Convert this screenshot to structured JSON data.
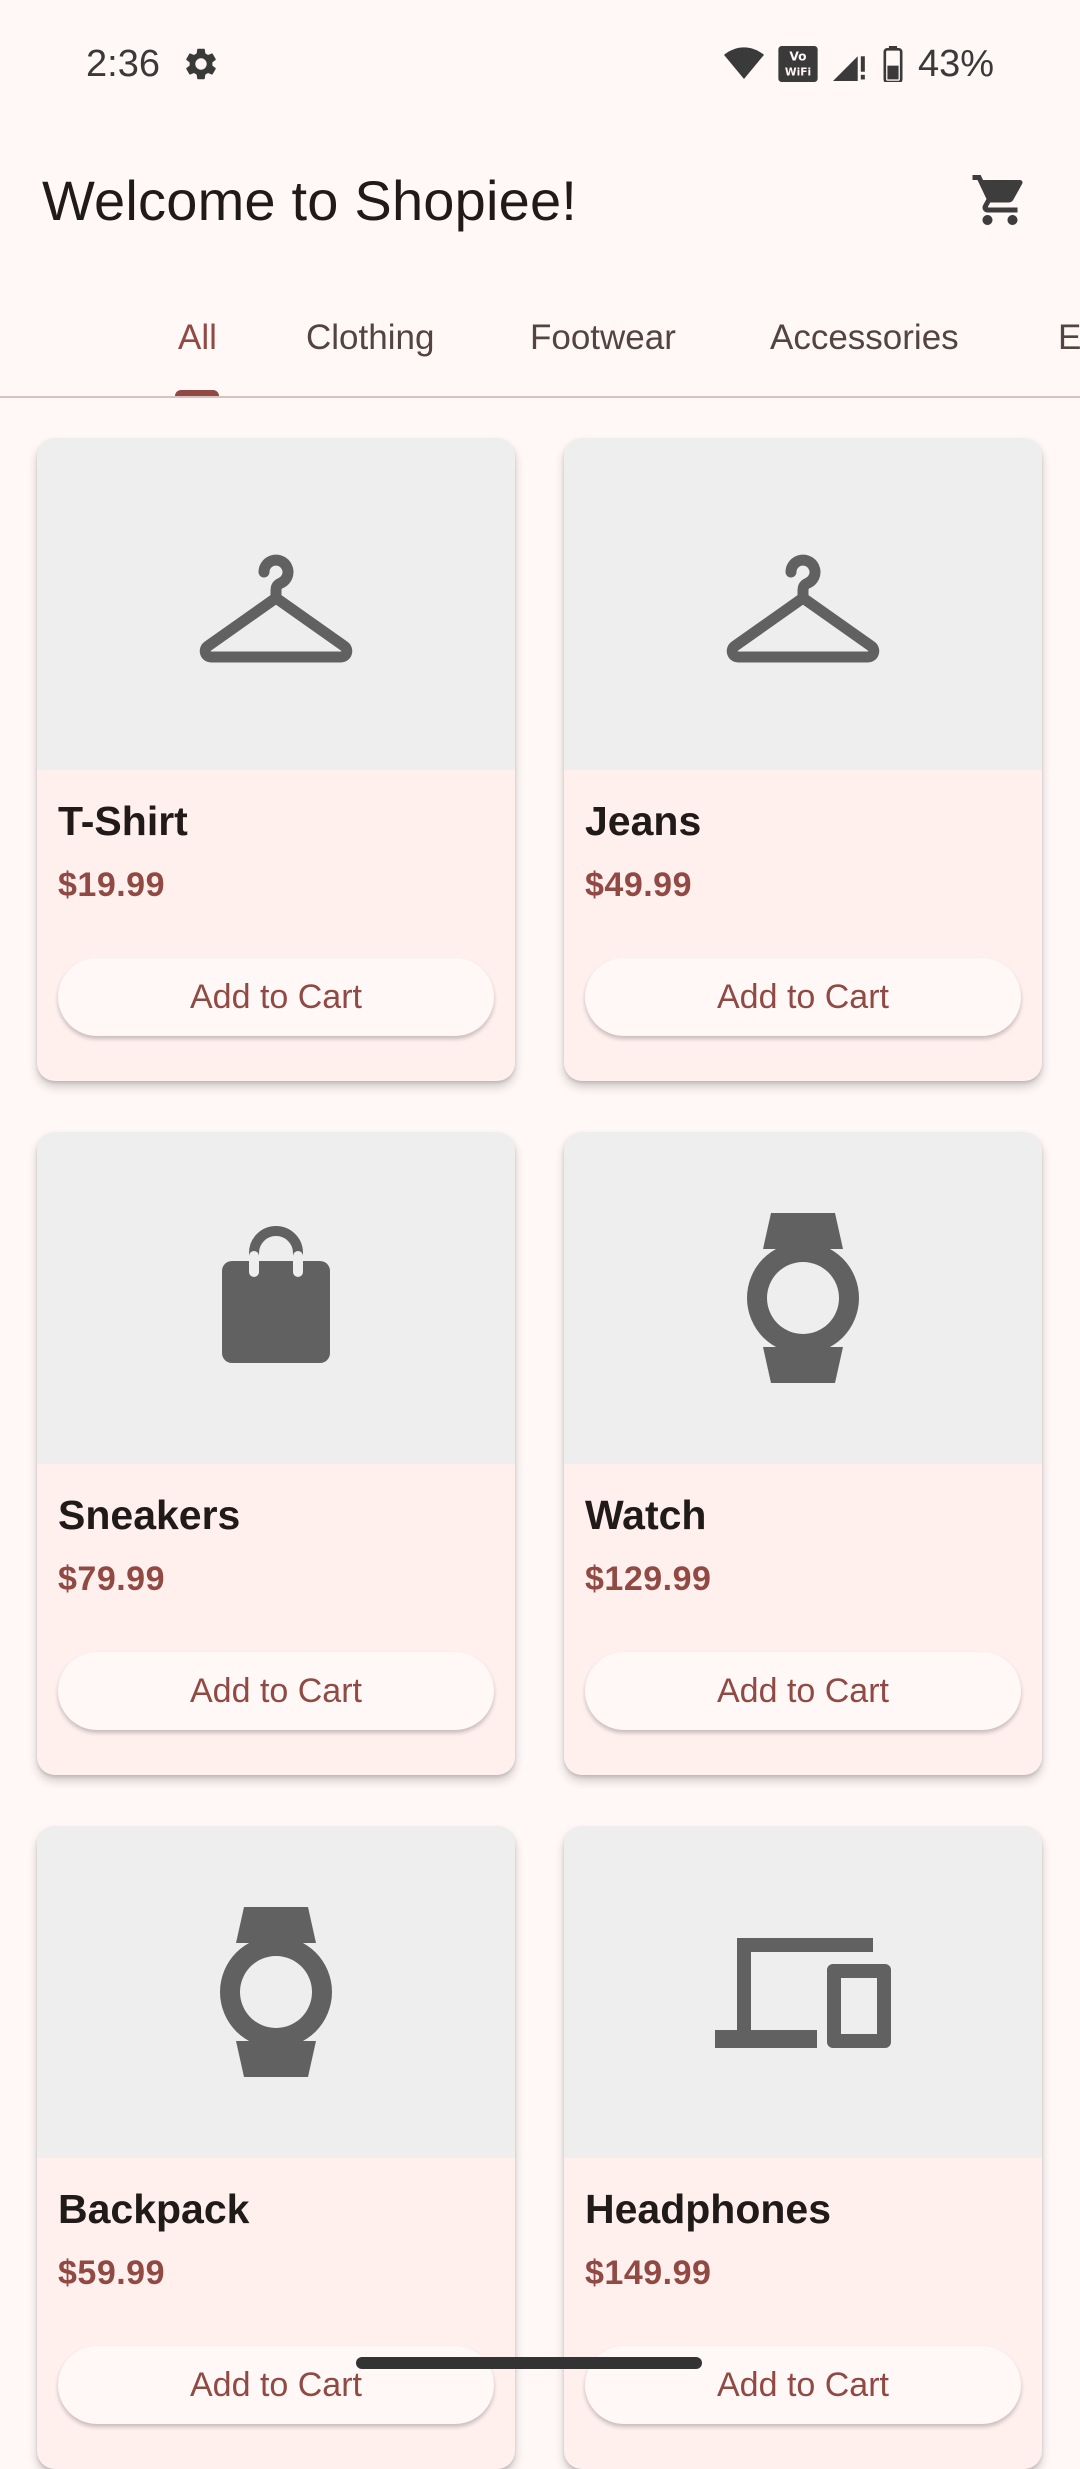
{
  "status_bar": {
    "time": "2:36",
    "battery": "43%",
    "icons": [
      "settings-icon",
      "wifi-icon",
      "vowifi-icon",
      "signal-icon",
      "battery-icon"
    ]
  },
  "app_bar": {
    "title": "Welcome to Shopiee!",
    "cart_icon": "shopping-cart-icon"
  },
  "tabs": [
    {
      "label": "All",
      "active": true
    },
    {
      "label": "Clothing",
      "active": false
    },
    {
      "label": "Footwear",
      "active": false
    },
    {
      "label": "Accessories",
      "active": false
    },
    {
      "label": "E",
      "active": false
    }
  ],
  "products": [
    {
      "name": "T-Shirt",
      "price": "$19.99",
      "icon": "hanger-icon",
      "button": "Add to Cart"
    },
    {
      "name": "Jeans",
      "price": "$49.99",
      "icon": "hanger-icon",
      "button": "Add to Cart"
    },
    {
      "name": "Sneakers",
      "price": "$79.99",
      "icon": "shopping-bag-icon",
      "button": "Add to Cart"
    },
    {
      "name": "Watch",
      "price": "$129.99",
      "icon": "watch-icon",
      "button": "Add to Cart"
    },
    {
      "name": "Backpack",
      "price": "$59.99",
      "icon": "watch-icon",
      "button": "Add to Cart"
    },
    {
      "name": "Headphones",
      "price": "$149.99",
      "icon": "devices-icon",
      "button": "Add to Cart"
    }
  ],
  "colors": {
    "accent": "#904a43",
    "background": "#fff8f7",
    "card": "#fff0ee",
    "image_bg": "#eeeeee",
    "icon": "#616161"
  }
}
